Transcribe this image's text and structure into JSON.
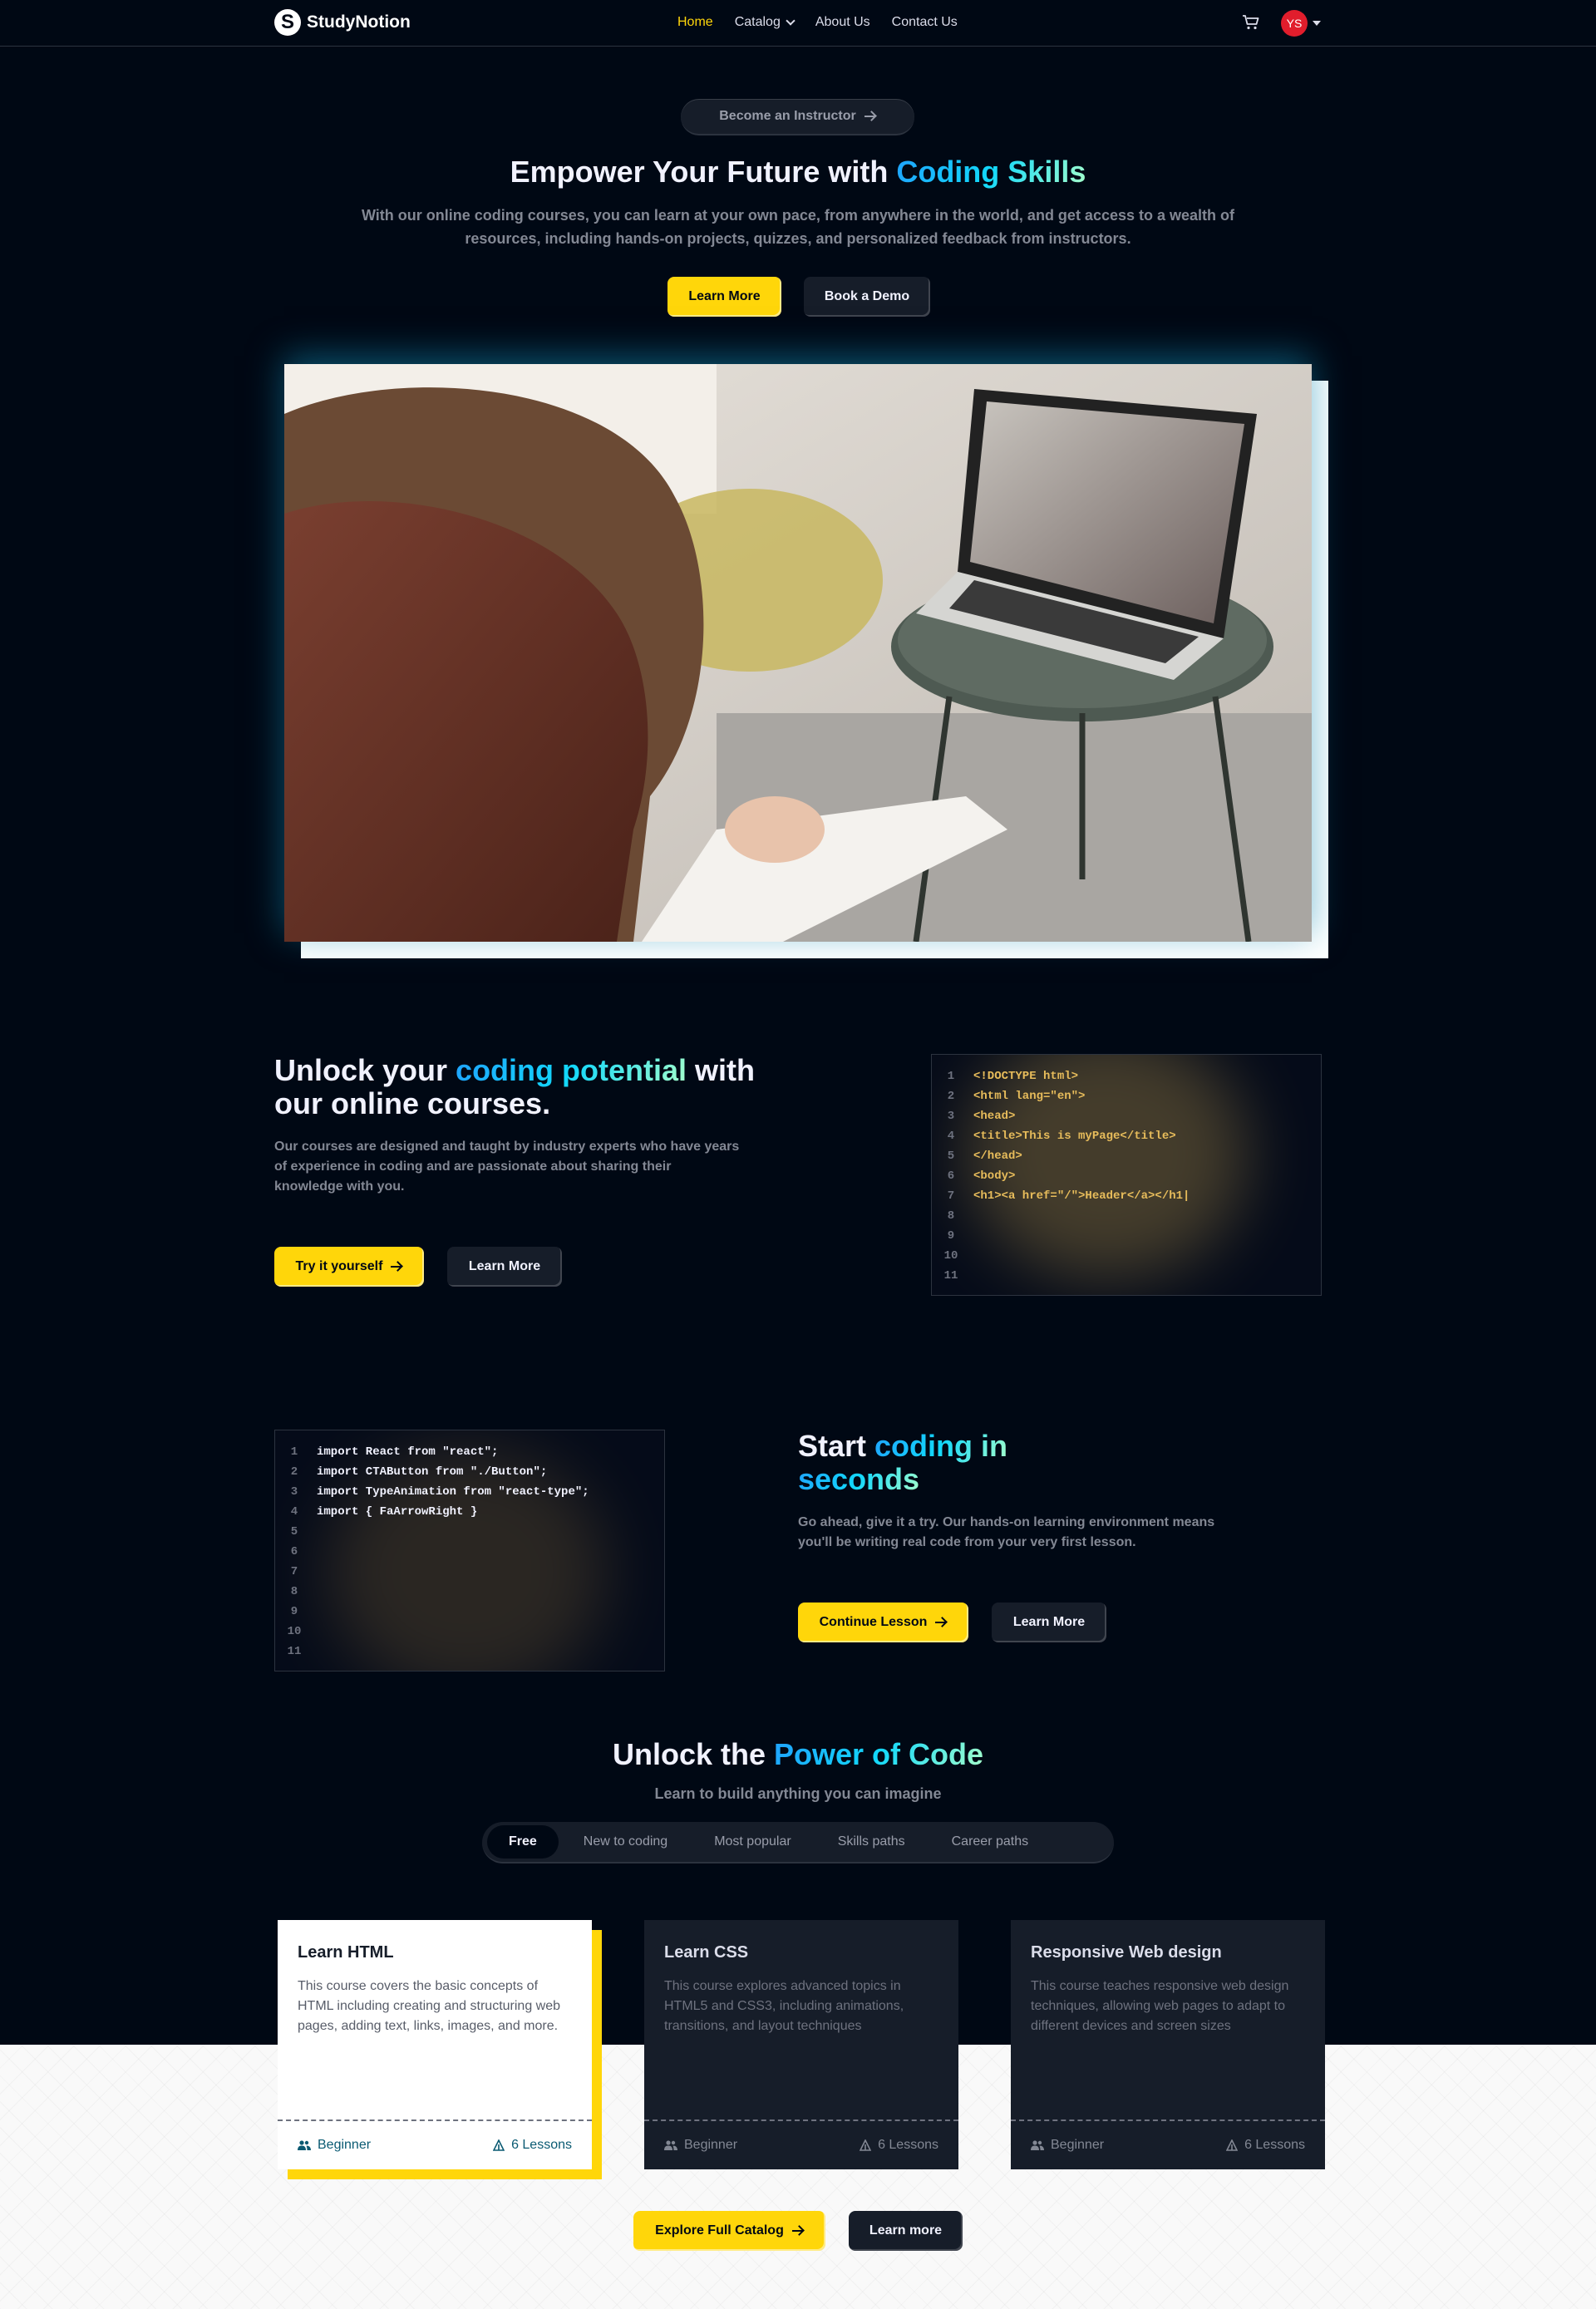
{
  "nav": {
    "logo_text": "StudyNotion",
    "logo_letter": "S",
    "links": [
      "Home",
      "Catalog",
      "About Us",
      "Contact Us"
    ],
    "avatar_initials": "YS"
  },
  "hero": {
    "instructor_pill": "Become an Instructor",
    "title_plain": "Empower Your Future with ",
    "title_highlight": "Coding Skills",
    "subtitle": "With our online coding courses, you can learn at your own pace, from anywhere in the world, and get access to a wealth of resources, including hands-on projects, quizzes, and personalized feedback from instructors.",
    "btn_primary": "Learn More",
    "btn_secondary": "Book a Demo"
  },
  "section1": {
    "title_a": "Unlock your ",
    "title_highlight": "coding potential",
    "title_b": " with",
    "title_c": "our online courses.",
    "text": "Our courses are designed and taught by industry experts who have years of experience in coding and are passionate about sharing their knowledge with you.",
    "btn_primary": "Try it yourself",
    "btn_secondary": "Learn More",
    "code_lines": [
      "<!DOCTYPE html>",
      "<html lang=\"en\">",
      "<head>",
      "<title>This is myPage</title>",
      "</head>",
      "<body>",
      "<h1><a href=\"/\">Header</a></h1|"
    ],
    "code_color": "#e7bc5b"
  },
  "section2": {
    "title_a": "Start ",
    "title_highlight": "coding in",
    "title_highlight2": "seconds",
    "text": "Go ahead, give it a try. Our hands-on learning environment means you'll be writing real code from your very first lesson.",
    "btn_primary": "Continue Lesson",
    "btn_secondary": "Learn More",
    "code_lines": [
      "import React from \"react\";",
      "import CTAButton from \"./Button\";",
      "import TypeAnimation from \"react-type\";",
      "import { FaArrowRight }"
    ],
    "code_color": "#f1f2ff"
  },
  "line_numbers": [
    "1",
    "2",
    "3",
    "4",
    "5",
    "6",
    "7",
    "8",
    "9",
    "10",
    "11"
  ],
  "power": {
    "title_plain": "Unlock the ",
    "title_highlight": "Power of Code",
    "subtitle": "Learn to build anything you can imagine",
    "tabs": [
      "Free",
      "New to coding",
      "Most popular",
      "Skills paths",
      "Career paths"
    ],
    "active_tab": "Free"
  },
  "cards": [
    {
      "title": "Learn HTML",
      "desc": "This course covers the basic concepts of HTML including creating and structuring web pages, adding text, links, images, and more.",
      "level": "Beginner",
      "lessons": "6 Lessons"
    },
    {
      "title": "Learn CSS",
      "desc": "This course explores advanced topics in HTML5 and CSS3, including animations, transitions, and layout techniques",
      "level": "Beginner",
      "lessons": "6 Lessons"
    },
    {
      "title": "Responsive Web design",
      "desc": "This course teaches responsive web design techniques, allowing web pages to adapt to different devices and screen sizes",
      "level": "Beginner",
      "lessons": "6 Lessons"
    }
  ],
  "catalog": {
    "btn_primary": "Explore Full Catalog",
    "btn_secondary": "Learn more"
  },
  "colors": {
    "accent_yellow": "#ffd60a",
    "background": "#000814",
    "card_bg": "#161d29"
  }
}
